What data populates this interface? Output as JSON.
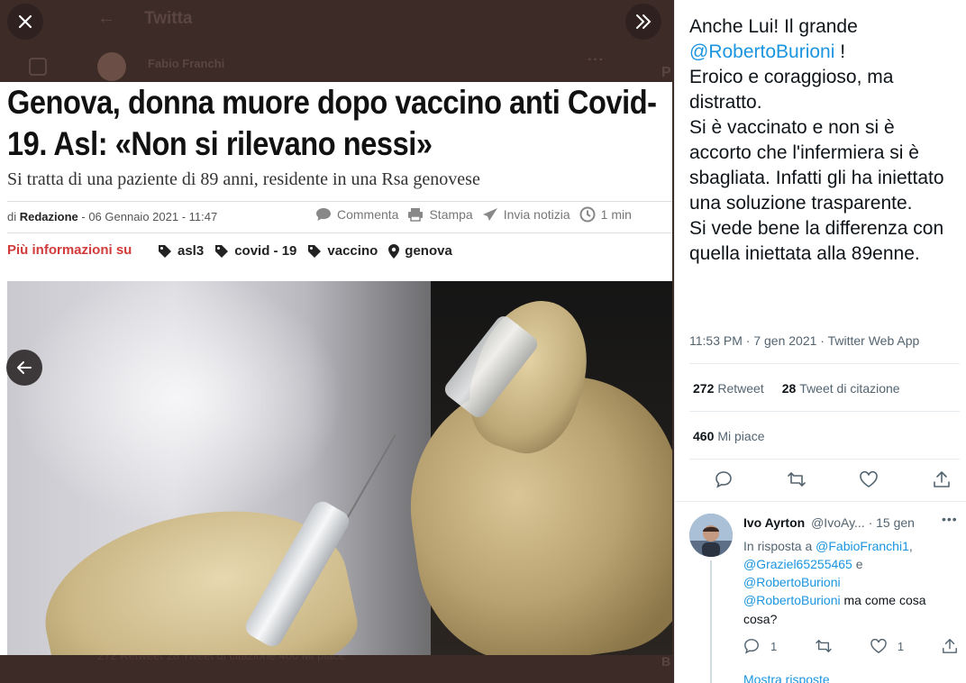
{
  "background_page": {
    "title": "Twitta",
    "author_name": "Fabio Franchi",
    "stats_text": "272 Retweet   28 Tweet di citazione   460 Mi piace",
    "side_letter_p": "P",
    "side_letter_b": "B"
  },
  "viewer": {
    "close_icon": "close-icon",
    "expand_icon": "chevron-double-right-icon",
    "prev_icon": "arrow-left-icon"
  },
  "article": {
    "headline": "Genova, donna muore dopo vaccino anti Covid-19. Asl: «Non si rilevano nessi»",
    "subtitle": "Si tratta di una paziente di 89 anni, residente in una Rsa genovese",
    "byline_prefix": "di",
    "byline_author": "Redazione",
    "byline_date": "- 06 Gennaio 2021 - 11:47",
    "actions": [
      {
        "label": "Commenta",
        "icon": "comment-icon"
      },
      {
        "label": "Stampa",
        "icon": "print-icon"
      },
      {
        "label": "Invia notizia",
        "icon": "send-icon"
      },
      {
        "label": "1 min",
        "icon": "clock-icon"
      }
    ],
    "more_info_label": "Più informazioni su",
    "tags": [
      {
        "label": "asl3",
        "icon": "tag-icon"
      },
      {
        "label": "covid - 19",
        "icon": "tag-icon"
      },
      {
        "label": "vaccino",
        "icon": "tag-icon"
      },
      {
        "label": "genova",
        "icon": "location-pin-icon"
      }
    ]
  },
  "tweet": {
    "text_lines": [
      "Anche Lui! Il grande",
      "@RobertoBurioni",
      "!",
      "Eroico e coraggioso, ma distratto.",
      "Si è vaccinato e non si è accorto che l'infermiera si è sbagliata. Infatti gli ha iniettato una soluzione trasparente.",
      "Si vede bene la differenza con quella iniettata alla 89enne."
    ],
    "meta": "11:53 PM · 7 gen 2021 · Twitter Web App",
    "retweets_count": "272",
    "retweets_label": "Retweet",
    "quotes_count": "28",
    "quotes_label": "Tweet di citazione",
    "likes_count": "460",
    "likes_label": "Mi piace"
  },
  "reply": {
    "name": "Ivo Ayrton",
    "handle": "@IvoAy...",
    "date": "· 15 gen",
    "more": "•••",
    "replying_to_prefix": "In risposta a",
    "replying_to_1": "@FabioFranchi1",
    "replying_to_sep": ",",
    "replying_to_2": "@Graziel65255465",
    "replying_to_and": "e",
    "replying_to_3": "@RobertoBurioni",
    "body_mention": "@RobertoBurioni",
    "body_text": "ma come cosa cosa?",
    "reply_count": "1",
    "like_count": "1",
    "show_replies": "Mostra risposte"
  },
  "colors": {
    "accent": "#1b95e0",
    "text": "#0f1419",
    "muted": "#536471",
    "viewer_bg": "#3d2b27",
    "tag_red": "#d23b3b"
  }
}
